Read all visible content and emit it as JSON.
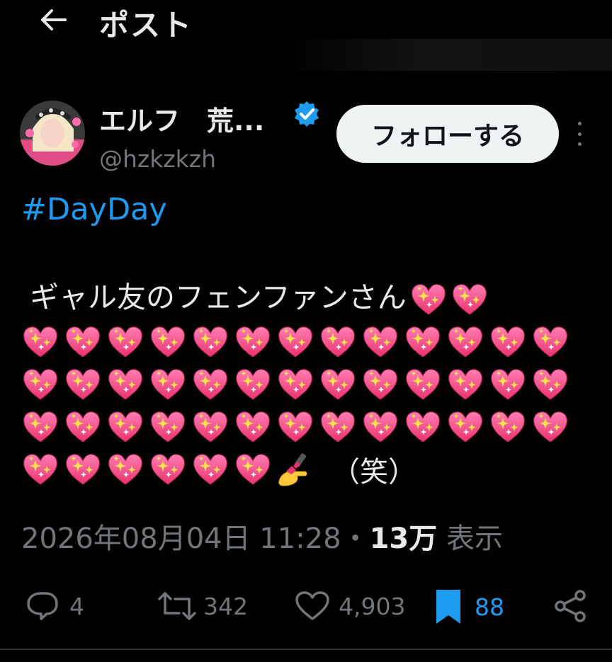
{
  "header": {
    "title": "ポスト",
    "back_icon": "back-arrow-icon"
  },
  "author": {
    "display_name": "エルフ　荒...",
    "handle": "@hzkzkzh",
    "verified": true,
    "verified_color": "#1d9bf0"
  },
  "follow_button": {
    "label": "フォローする"
  },
  "post": {
    "hashtag": "#DayDay",
    "text": "ギャル友のフェンファンさん",
    "emoji_name": "sparkling-heart-icon",
    "nail_emoji_name": "nail-polish-icon",
    "laugh": "（笑）",
    "inline_heart_count": 2,
    "full_rows": 3,
    "hearts_per_row": 13,
    "last_row_hearts": 6
  },
  "meta": {
    "timestamp": "2026年08月04日 11:28",
    "separator": "・",
    "views_count": "13万",
    "views_label": "表示"
  },
  "actions": {
    "replies": "4",
    "reposts": "342",
    "likes": "4,903",
    "bookmarks": "88"
  },
  "colors": {
    "background": "#000000",
    "text": "#e7e9ea",
    "secondary": "#71767b",
    "accent": "#1d9bf0",
    "heart": "#f0508a"
  }
}
